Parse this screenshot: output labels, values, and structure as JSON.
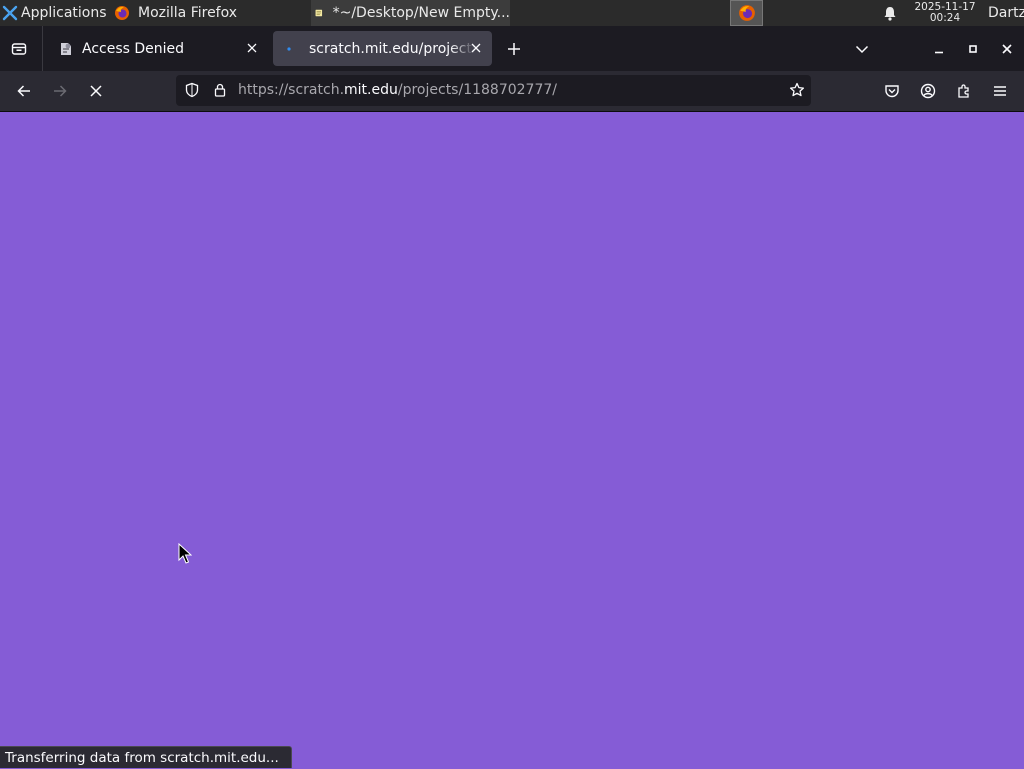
{
  "panel": {
    "apps_label": "Applications",
    "task_firefox": "Mozilla Firefox",
    "task_editor": "*~/Desktop/New Empty...",
    "clock_date": "2025-11-17",
    "clock_time": "00:24",
    "user": "Dartz"
  },
  "tabs": [
    {
      "title": "Access Denied",
      "active": false
    },
    {
      "title": "scratch.mit.edu/projects/",
      "active": true
    }
  ],
  "navbar": {
    "url_prefix": "https://scratch.",
    "url_host": "mit.edu",
    "url_path": "/projects/1188702777/"
  },
  "status_text": "Transferring data from scratch.mit.edu...",
  "colors": {
    "page_background": "#855cd6",
    "loading_tab_dot": "#2f8cf0"
  }
}
